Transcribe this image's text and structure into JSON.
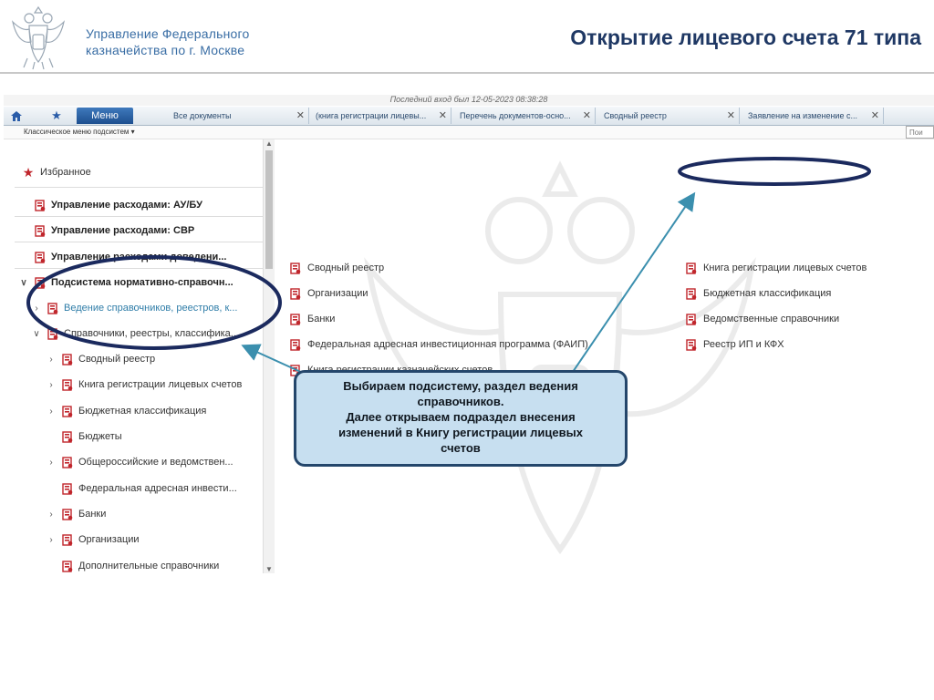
{
  "slide": {
    "org_line1": "Управление Федерального",
    "org_line2": "казначейства  по г. Москве",
    "title": "Открытие лицевого счета 71 типа"
  },
  "app": {
    "login_strip": "Последний вход был  12-05-2023 08:38:28",
    "menu_tab": "Меню",
    "tabs": [
      {
        "label": "Все документы"
      },
      {
        "label": "(книга регистрации лицевы..."
      },
      {
        "label": "Перечень документов-осно..."
      },
      {
        "label": "Сводный реестр"
      },
      {
        "label": "Заявление на изменение с..."
      }
    ],
    "menubar_label": "Классическое меню подсистем  ▾",
    "search_placeholder": "Пои",
    "tree": [
      {
        "label": "Избранное",
        "icon": "star-icon"
      },
      {
        "label": "Управление расходами: АУ/БУ",
        "icon": "document-icon"
      },
      {
        "label": "Управление расходами: СВР",
        "icon": "document-icon"
      },
      {
        "label": "Управление расходами доведени...",
        "icon": "document-icon"
      },
      {
        "label": "Подсистема нормативно-справочн...",
        "icon": "document-icon"
      },
      {
        "label": "Ведение справочников, реестров, к...",
        "icon": "document-icon"
      },
      {
        "label": "Справочники, реестры, классифика...",
        "icon": "document-icon"
      },
      {
        "label": "Сводный реестр",
        "icon": "document-icon"
      },
      {
        "label": "Книга регистрации лицевых счетов",
        "icon": "document-icon"
      },
      {
        "label": "Бюджетная классификация",
        "icon": "document-icon"
      },
      {
        "label": "Бюджеты",
        "icon": "document-icon"
      },
      {
        "label": "Общероссийские и ведомствен...",
        "icon": "document-icon"
      },
      {
        "label": "Федеральная адресная инвести...",
        "icon": "document-icon"
      },
      {
        "label": "Банки",
        "icon": "document-icon"
      },
      {
        "label": "Организации",
        "icon": "document-icon"
      },
      {
        "label": "Дополнительные справочники",
        "icon": "document-icon"
      }
    ],
    "content_left": [
      {
        "label": "Сводный реестр"
      },
      {
        "label": "Организации"
      },
      {
        "label": "Банки"
      },
      {
        "label": "Федеральная адресная инвестиционная программа (ФАИП)"
      },
      {
        "label": "Книга регистрации казначейских счетов"
      }
    ],
    "content_right": [
      {
        "label": "Книга регистрации лицевых счетов"
      },
      {
        "label": "Бюджетная классификация"
      },
      {
        "label": "Ведомственные справочники"
      },
      {
        "label": "Реестр ИП и КФХ"
      }
    ]
  },
  "callout": {
    "line1": "Выбираем подсистему, раздел ведения",
    "line2": "справочников.",
    "line3": "Далее открываем подраздел внесения",
    "line4": "изменений в Книгу регистрации лицевых",
    "line5": "счетов"
  },
  "colors": {
    "accent": "#1d4f8f",
    "title": "#1f3864",
    "org": "#3a6ea5",
    "icon_red": "#c0262c",
    "annotation_ring": "#1b2a5e",
    "arrow": "#3b8fae"
  }
}
